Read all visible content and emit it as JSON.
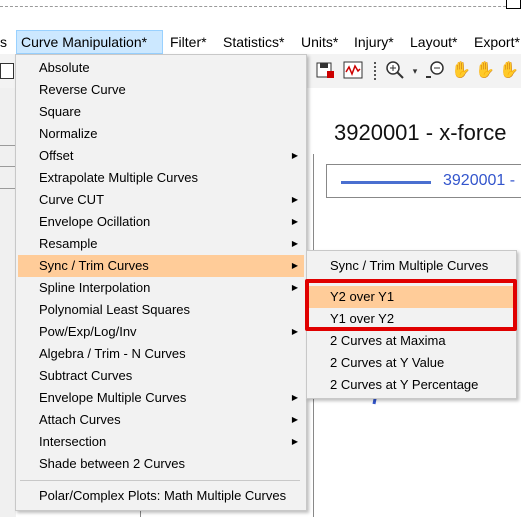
{
  "menubar": {
    "items": [
      {
        "label": "s"
      },
      {
        "label": "Curve Manipulation*"
      },
      {
        "label": "Filter*"
      },
      {
        "label": "Statistics*"
      },
      {
        "label": "Units*"
      },
      {
        "label": "Injury*"
      },
      {
        "label": "Layout*"
      },
      {
        "label": "Export*"
      }
    ]
  },
  "toolbar": {
    "icons": [
      "save-chart-icon",
      "waveform-icon",
      "zoom-icon",
      "zoom-out-icon",
      "pan-hand-icon",
      "pan-vertical-hand-icon",
      "pan-horizontal-hand-icon",
      "hand-move-icon"
    ]
  },
  "plot": {
    "title": "3920001 - x-force",
    "legend_label": "3920001 -",
    "line_color": "#4a6fd0"
  },
  "dropdown": {
    "items": [
      {
        "label": "Absolute"
      },
      {
        "label": "Reverse Curve"
      },
      {
        "label": "Square"
      },
      {
        "label": "Normalize"
      },
      {
        "label": "Offset"
      },
      {
        "label": "Extrapolate Multiple Curves"
      },
      {
        "label": "Curve CUT"
      },
      {
        "label": "Envelope Ocillation"
      },
      {
        "label": "Resample"
      },
      {
        "label": "Sync / Trim Curves"
      },
      {
        "label": "Spline Interpolation"
      },
      {
        "label": "Polynomial Least Squares"
      },
      {
        "label": "Pow/Exp/Log/Inv"
      },
      {
        "label": "Algebra / Trim - N Curves"
      },
      {
        "label": "Subtract Curves"
      },
      {
        "label": "Envelope Multiple Curves"
      },
      {
        "label": "Attach Curves"
      },
      {
        "label": "Intersection"
      },
      {
        "label": "Shade between 2 Curves"
      },
      {
        "label": "Polar/Complex Plots: Math Multiple Curves"
      }
    ]
  },
  "submenu": {
    "items": [
      {
        "label": "Sync / Trim Multiple Curves"
      },
      {
        "label": "Y2 over Y1"
      },
      {
        "label": "Y1 over Y2"
      },
      {
        "label": "2 Curves at Maxima"
      },
      {
        "label": "2 Curves at Y Value"
      },
      {
        "label": "2 Curves at Y Percentage"
      }
    ]
  },
  "colors": {
    "highlight": "#ffcc99",
    "annotation_box": "#e00000",
    "active_menu": "#cce8ff"
  }
}
